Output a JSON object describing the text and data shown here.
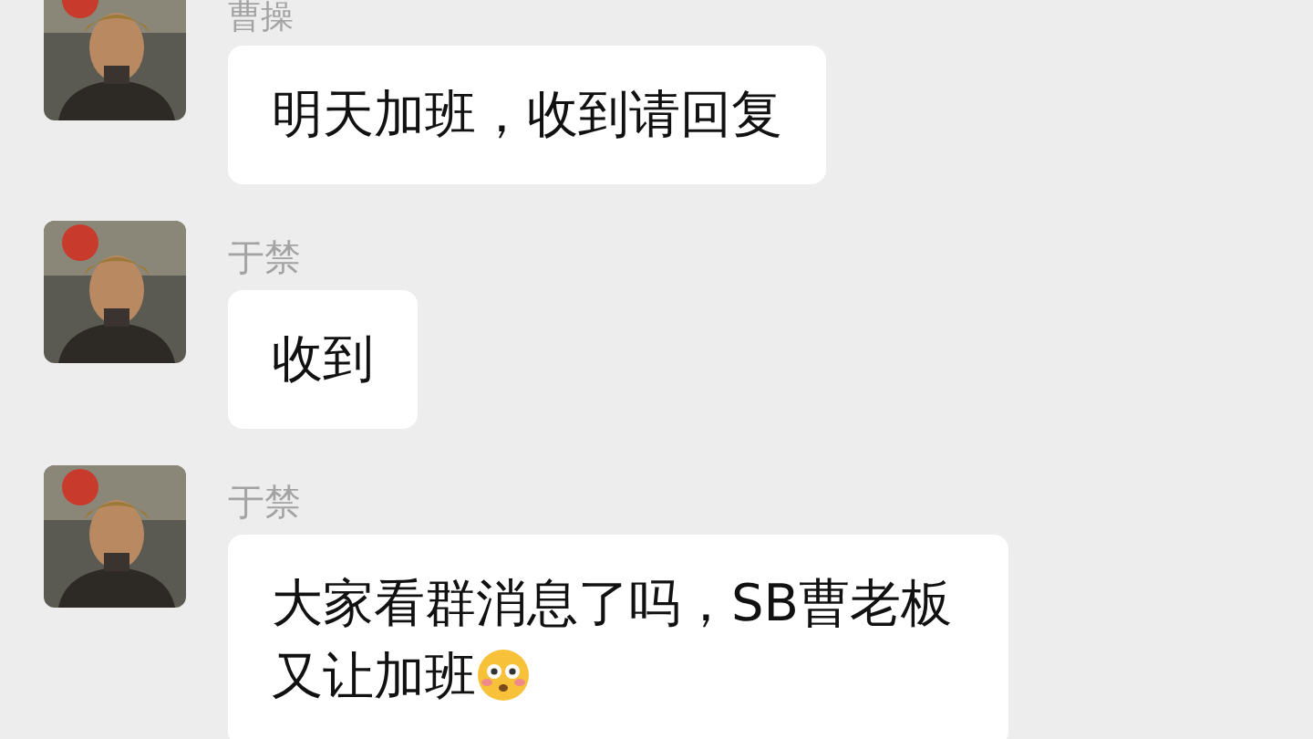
{
  "messages": [
    {
      "sender": "曹操",
      "text": "明天加班，收到请回复",
      "emoji": false
    },
    {
      "sender": "于禁",
      "text": "收到",
      "emoji": false
    },
    {
      "sender": "于禁",
      "text": "大家看群消息了吗，SB曹老板又让加班",
      "emoji": true
    }
  ]
}
